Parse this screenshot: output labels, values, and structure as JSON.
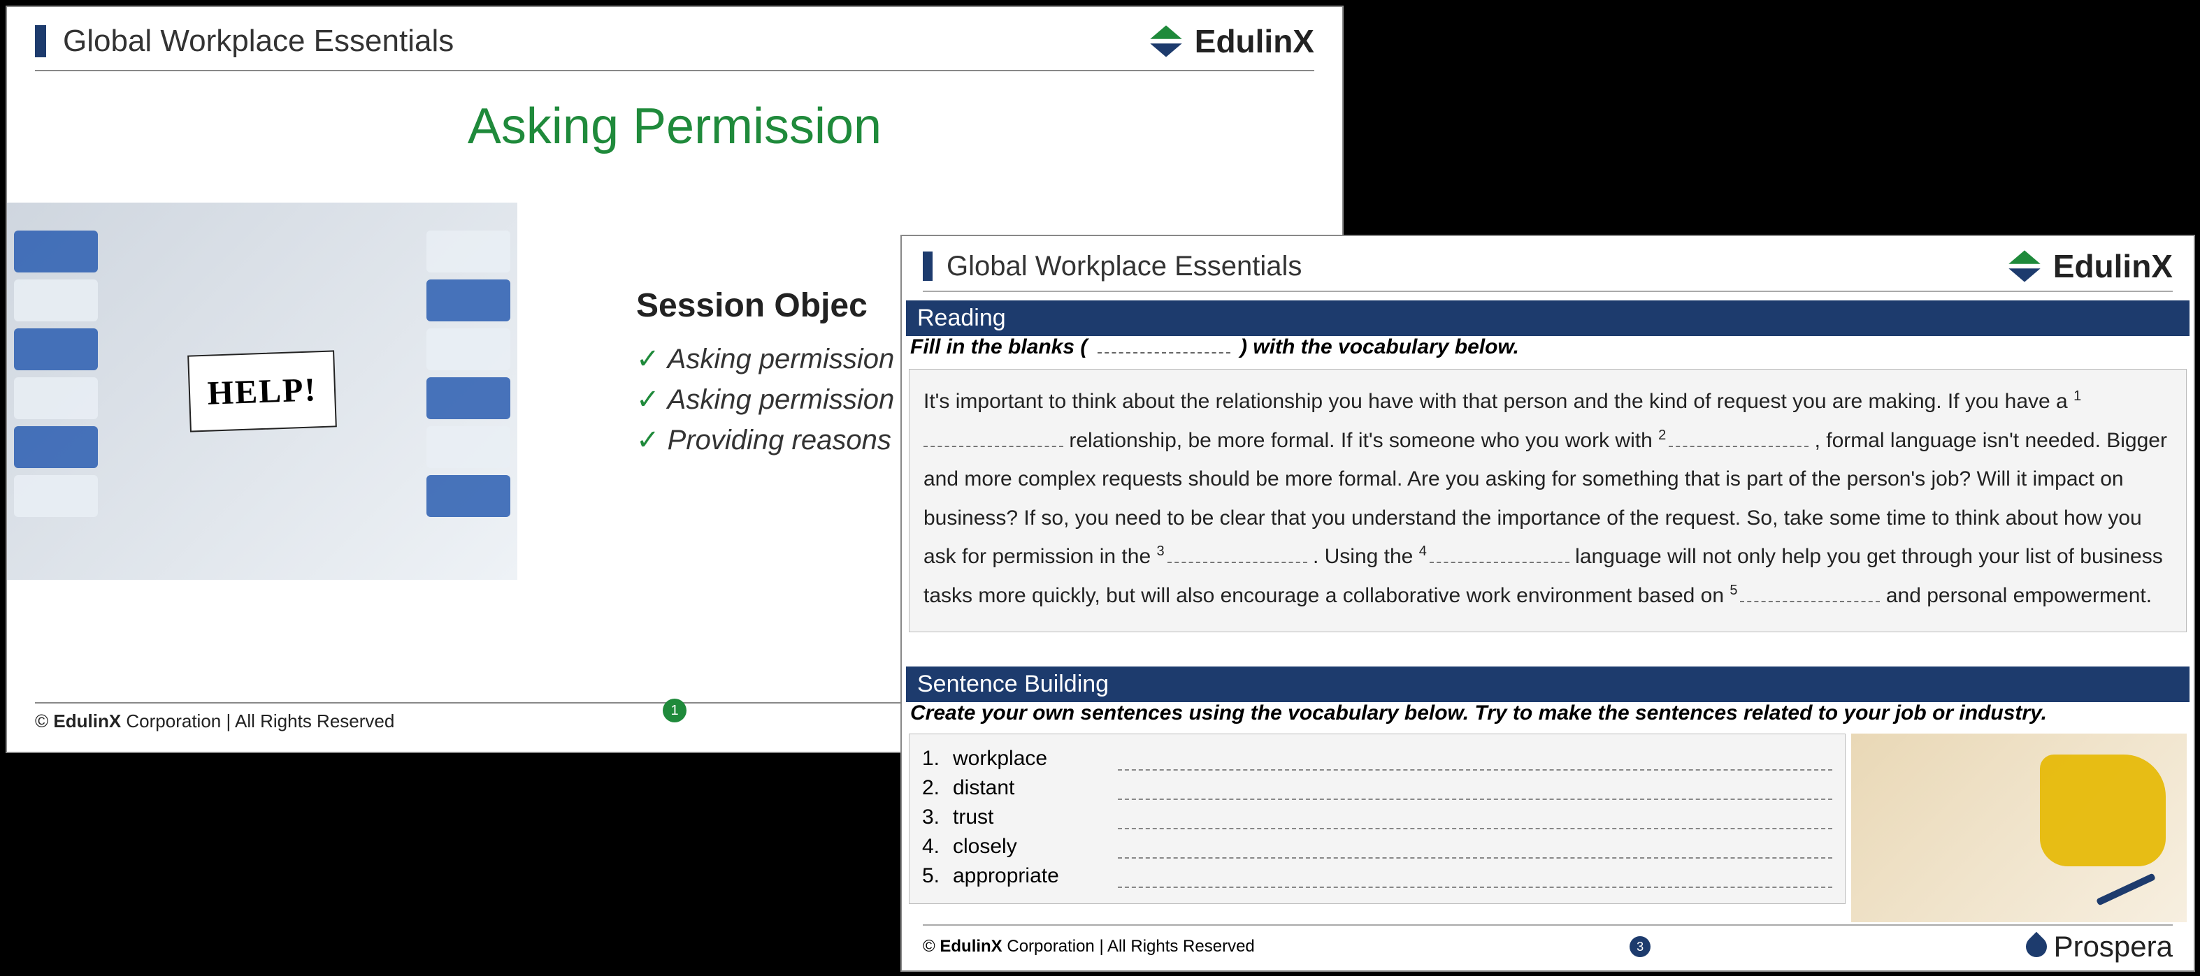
{
  "slide1": {
    "course_title": "Global Workplace Essentials",
    "logo_text": "EdulinX",
    "main_title": "Asking Permission",
    "help_card": "HELP!",
    "objectives_heading": "Session Objec",
    "objectives": [
      "Asking permission ",
      "Asking permission ",
      "Providing reasons "
    ],
    "copyright_prefix": "© ",
    "copyright_brand": "EdulinX",
    "copyright_suffix": " Corporation | All Rights Reserved",
    "page_number": "1"
  },
  "slide3": {
    "course_title": "Global Workplace Essentials",
    "logo_text": "EdulinX",
    "reading_label": "Reading",
    "reading_instruction_pre": "Fill in the blanks ( ",
    "reading_instruction_post": " ) with the vocabulary below.",
    "passage": {
      "p1": "It's important to think about the relationship you have with that person and the kind of request you are making. If you have a ",
      "n1": "1",
      "p2": " relationship, be more formal. If it's someone who you work with ",
      "n2": "2",
      "p3": ", formal language isn't needed. Bigger and more complex requests should be more formal. Are you asking for something that is part of the person's job? Will it impact on business? If so, you need to be clear that you understand the importance of the request. So, take some time to think about how you ask for permission in the ",
      "n3": "3",
      "p4": ". Using the ",
      "n4": "4",
      "p5": " language will not only help you get through your list of business tasks more quickly, but will also encourage a collaborative work environment based on ",
      "n5": "5",
      "p6": " and personal empowerment."
    },
    "sb_label": "Sentence Building",
    "sb_instruction": "Create your own sentences using the vocabulary below. Try to make the sentences related to your job or industry.",
    "vocab": [
      {
        "n": "1.",
        "w": "workplace"
      },
      {
        "n": "2.",
        "w": "distant"
      },
      {
        "n": "3.",
        "w": "trust"
      },
      {
        "n": "4.",
        "w": "closely"
      },
      {
        "n": "5.",
        "w": "appropriate"
      }
    ],
    "copyright_prefix": "© ",
    "copyright_brand": "EdulinX",
    "copyright_suffix": " Corporation | All Rights Reserved",
    "page_number": "3",
    "footer_brand": "Prospera"
  }
}
